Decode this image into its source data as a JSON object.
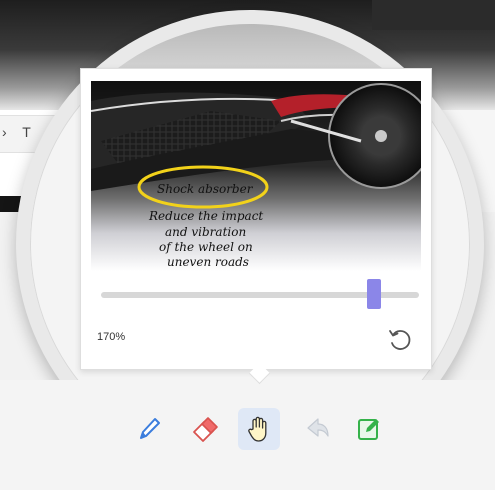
{
  "zoom": {
    "level_label": "170%",
    "slider_fraction": 0.86
  },
  "preview": {
    "annotation_title": "Shock absorber",
    "annotation_lines": [
      "Reduce the impact",
      "and vibration",
      "of the wheel on",
      "uneven roads"
    ],
    "highlight_color": "#f2d21a",
    "ink_color": "#111111"
  },
  "toolbar": {
    "tools": [
      {
        "name": "pen-tool",
        "icon": "pen-icon",
        "selected": false
      },
      {
        "name": "eraser-tool",
        "icon": "eraser-icon",
        "selected": false
      },
      {
        "name": "hand-tool",
        "icon": "hand-icon",
        "selected": true
      },
      {
        "name": "undo-tool",
        "icon": "undo-arrow-icon",
        "selected": false
      },
      {
        "name": "note-tool",
        "icon": "edit-note-icon",
        "selected": false
      }
    ],
    "accent_color": "#3b7ddd",
    "selected_bg": "#dfe8f6",
    "note_color": "#35b24a",
    "eraser_color": "#f06a6a"
  },
  "slider_color": "#8b86e8"
}
